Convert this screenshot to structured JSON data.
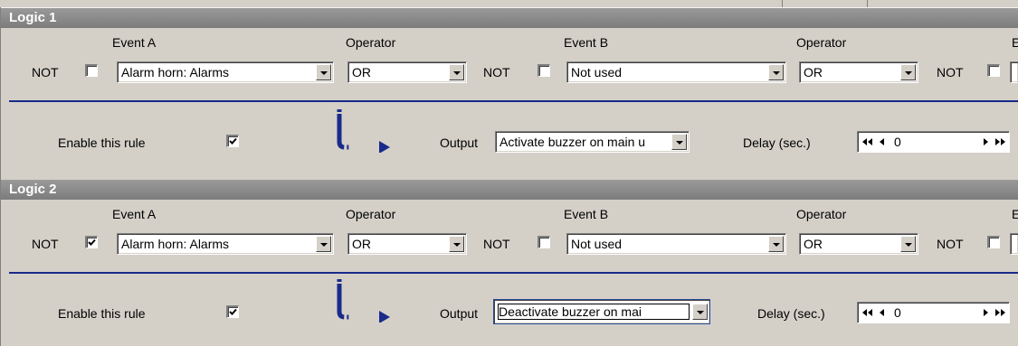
{
  "rules": [
    {
      "title": "Logic 1",
      "labels": {
        "event_a": "Event A",
        "operator1": "Operator",
        "event_b": "Event B",
        "operator2": "Operator",
        "not": "NOT"
      },
      "not_a_checked": false,
      "event_a": "Alarm horn: Alarms",
      "operator1": "OR",
      "not_b_checked": false,
      "event_b": "Not used",
      "operator2": "OR",
      "not_c_checked": false,
      "enable_label": "Enable this rule",
      "enable_checked": true,
      "output_label": "Output",
      "output_value": "Activate buzzer on main u",
      "delay_label": "Delay (sec.)",
      "delay_value": "0"
    },
    {
      "title": "Logic 2",
      "labels": {
        "event_a": "Event A",
        "operator1": "Operator",
        "event_b": "Event B",
        "operator2": "Operator",
        "not": "NOT"
      },
      "not_a_checked": true,
      "event_a": "Alarm horn: Alarms",
      "operator1": "OR",
      "not_b_checked": false,
      "event_b": "Not used",
      "operator2": "OR",
      "not_c_checked": false,
      "enable_label": "Enable this rule",
      "enable_checked": true,
      "output_label": "Output",
      "output_value": "Deactivate buzzer on mai",
      "delay_label": "Delay (sec.)",
      "delay_value": "0"
    }
  ],
  "colors": {
    "header": "#7c7c7c",
    "divider": "#1a2a8a",
    "arrow": "#1a2a8a",
    "background": "#d4d0c8"
  }
}
